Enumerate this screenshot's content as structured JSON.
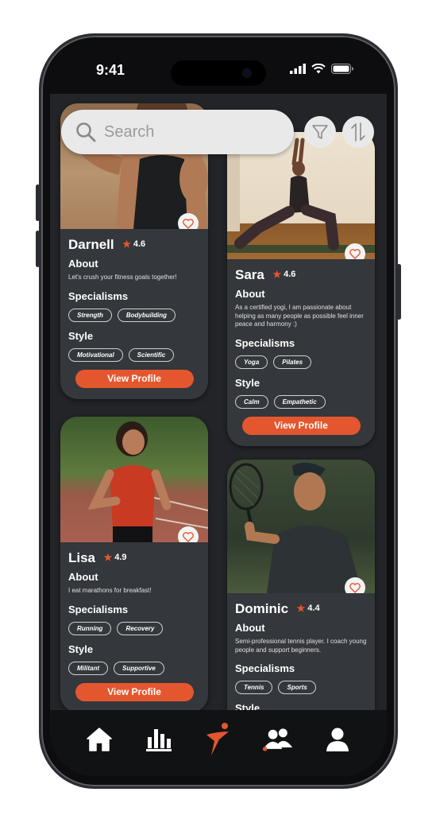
{
  "status": {
    "time": "9:41"
  },
  "search": {
    "placeholder": "Search"
  },
  "cards": [
    {
      "name": "Darnell",
      "rating": "4.6",
      "about_label": "About",
      "about": "Let's crush your fitness goals together!",
      "specialisms_label": "Specialisms",
      "specialisms": [
        "Strength",
        "Bodybuilding"
      ],
      "style_label": "Style",
      "styles": [
        "Motivational",
        "Scientific"
      ],
      "button": "View Profile"
    },
    {
      "name": "Sara",
      "rating": "4.6",
      "about_label": "About",
      "about": "As a certified yogi, I am passionate about helping as many people as possible feel inner peace and harmony :)",
      "specialisms_label": "Specialisms",
      "specialisms": [
        "Yoga",
        "Pilates"
      ],
      "style_label": "Style",
      "styles": [
        "Calm",
        "Empathetic"
      ],
      "button": "View Profile"
    },
    {
      "name": "Lisa",
      "rating": "4.9",
      "about_label": "About",
      "about": "I eat marathons for breakfast!",
      "specialisms_label": "Specialisms",
      "specialisms": [
        "Running",
        "Recovery"
      ],
      "style_label": "Style",
      "styles": [
        "Militant",
        "Supportive"
      ],
      "button": "View Profile"
    },
    {
      "name": "Dominic",
      "rating": "4.4",
      "about_label": "About",
      "about": "Semi-professional tennis player. I coach young people and support beginners.",
      "specialisms_label": "Specialisms",
      "specialisms": [
        "Tennis",
        "Sports"
      ],
      "style_label": "Style",
      "styles": [],
      "button": ""
    }
  ],
  "nav": {
    "items": [
      "home-icon",
      "stats-icon",
      "logo-icon",
      "community-icon",
      "profile-icon"
    ]
  },
  "colors": {
    "accent": "#e4572e",
    "card": "#34373c",
    "background": "#222428"
  }
}
